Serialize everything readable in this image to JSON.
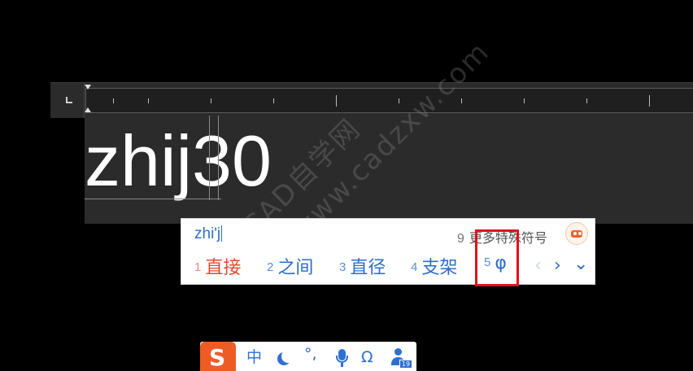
{
  "editor": {
    "text_before_caret": "zhij",
    "text_after_caret": "30"
  },
  "watermark": {
    "line1": "CAD自学网",
    "line2": "www.cadzxw.com"
  },
  "ime_panel": {
    "input": "zhi'j",
    "more_symbols_number": "9",
    "more_symbols_label": "更多特殊符号",
    "candidates": [
      {
        "index": "1",
        "text": "直接"
      },
      {
        "index": "2",
        "text": "之间"
      },
      {
        "index": "3",
        "text": "直径"
      },
      {
        "index": "4",
        "text": "支架"
      },
      {
        "index": "5",
        "text": "φ"
      }
    ],
    "nav": {
      "prev": "‹",
      "next": "›",
      "expand": "⌄"
    },
    "colors": {
      "first_candidate": "#e14b2e",
      "candidate": "#2b6fc9",
      "highlight_box": "#e0121b"
    }
  },
  "ime_bar": {
    "logo": "S",
    "mode": "中",
    "punct": "°,",
    "symbol": "Ω",
    "user_badge": "19",
    "icons": [
      "sogou-logo-icon",
      "moon-icon",
      "microphone-icon",
      "user-icon"
    ]
  }
}
